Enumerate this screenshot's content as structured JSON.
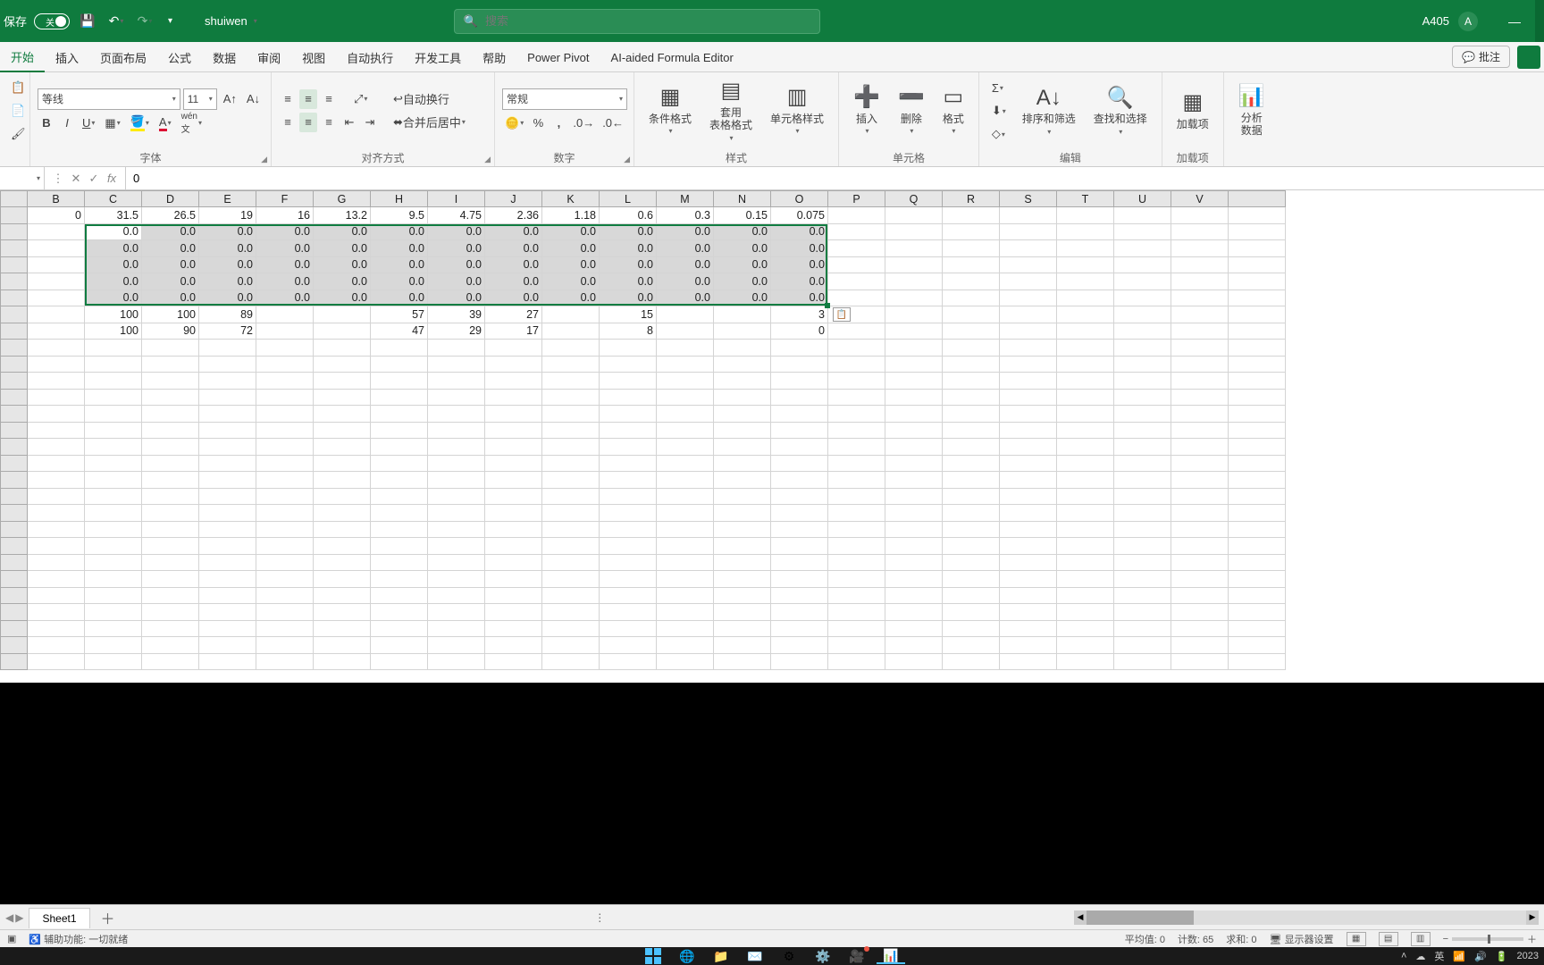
{
  "title": {
    "autosave_label": "保存",
    "toggle_state": "关",
    "filename": "shuiwen",
    "search_placeholder": "搜索",
    "cellref": "A405",
    "avatar": "A"
  },
  "tabs": [
    "开始",
    "插入",
    "页面布局",
    "公式",
    "数据",
    "审阅",
    "视图",
    "自动执行",
    "开发工具",
    "帮助",
    "Power Pivot",
    "AI-aided Formula Editor"
  ],
  "active_tab": 0,
  "comments_label": "批注",
  "ribbon": {
    "font": {
      "name": "等线",
      "size": "11",
      "group_label": "字体"
    },
    "align": {
      "wrap_label": "自动换行",
      "merge_label": "合并后居中",
      "group_label": "对齐方式"
    },
    "number": {
      "format": "常规",
      "group_label": "数字"
    },
    "styles": {
      "cond": "条件格式",
      "table": "套用\n表格格式",
      "cell": "单元格样式",
      "group_label": "样式"
    },
    "cells": {
      "insert": "插入",
      "delete": "删除",
      "format": "格式",
      "group_label": "单元格"
    },
    "editing": {
      "sort": "排序和筛选",
      "find": "查找和选择",
      "group_label": "编辑"
    },
    "addins": {
      "addin": "加载项",
      "group_label": "加载项"
    },
    "analyze": {
      "analyze": "分析\n数据"
    }
  },
  "formula_bar": {
    "value": "0"
  },
  "columns": [
    "B",
    "C",
    "D",
    "E",
    "F",
    "G",
    "H",
    "I",
    "J",
    "K",
    "L",
    "M",
    "N",
    "O",
    "P",
    "Q",
    "R",
    "S",
    "T",
    "U",
    "V",
    ""
  ],
  "sheet_data": {
    "row1": [
      "0",
      "31.5",
      "26.5",
      "19",
      "16",
      "13.2",
      "9.5",
      "4.75",
      "2.36",
      "1.18",
      "0.6",
      "0.3",
      "0.15",
      "0.075"
    ],
    "zeros": "0.0",
    "row7": [
      "",
      "100",
      "100",
      "89",
      "",
      "",
      "57",
      "39",
      "27",
      "",
      "15",
      "",
      "",
      "3"
    ],
    "row8": [
      "",
      "100",
      "90",
      "72",
      "",
      "",
      "47",
      "29",
      "17",
      "",
      "8",
      "",
      "",
      "0"
    ]
  },
  "selection": {
    "top_row": 2,
    "bottom_row": 6,
    "left_col": 2,
    "right_col": 14
  },
  "sheet_tabs": {
    "name": "Sheet1"
  },
  "status": {
    "ready": "辅助功能: 一切就绪",
    "avg": "平均值: 0",
    "count": "计数: 65",
    "sum": "求和: 0",
    "display": "显示器设置"
  },
  "tray": {
    "ime": "英",
    "time": "2023"
  }
}
